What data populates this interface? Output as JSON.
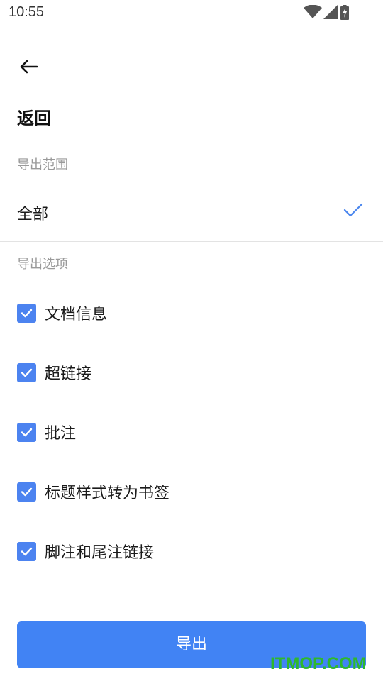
{
  "status_bar": {
    "time": "10:55",
    "icons": [
      "wifi-icon",
      "cellular-signal-icon",
      "battery-charging-icon"
    ]
  },
  "header": {
    "back_icon": "arrow-left-icon",
    "title": "返回"
  },
  "export_range": {
    "section_label": "导出范围",
    "selected_option": "全部",
    "check_icon": "checkmark-icon"
  },
  "export_options": {
    "section_label": "导出选项",
    "items": [
      {
        "label": "文档信息",
        "checked": true
      },
      {
        "label": "超链接",
        "checked": true
      },
      {
        "label": "批注",
        "checked": true
      },
      {
        "label": "标题样式转为书签",
        "checked": true
      },
      {
        "label": "脚注和尾注链接",
        "checked": true
      }
    ]
  },
  "export_button": {
    "label": "导出"
  },
  "watermark": {
    "text": "ITMOP.COM"
  },
  "colors": {
    "accent": "#4183f4",
    "checkbox": "#4c83f0",
    "section_label": "#9a9a9a",
    "watermark": "#2eb82e",
    "divider": "#e3e3e3"
  }
}
